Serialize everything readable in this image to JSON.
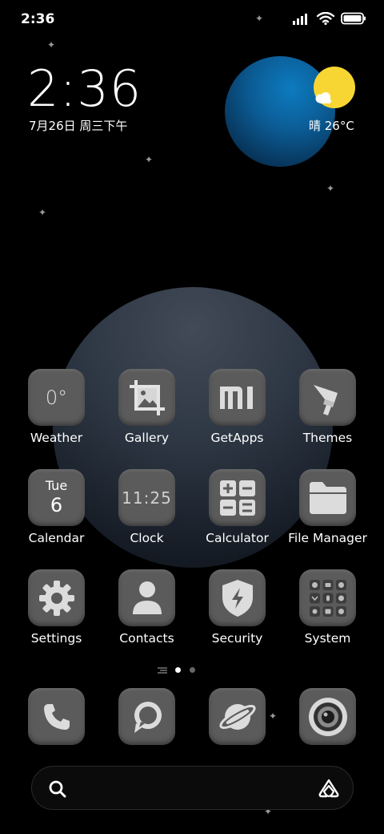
{
  "status_bar": {
    "time": "2:36",
    "icons": [
      "signal-icon",
      "wifi-icon",
      "battery-icon"
    ]
  },
  "widget": {
    "clock": "2:36",
    "date": "7月26日 周三下午",
    "weather": "晴 26°C",
    "weather_icon": "sunny-cloud-icon"
  },
  "apps": [
    {
      "label": "Weather",
      "icon": "weather-icon",
      "icon_text": "0°"
    },
    {
      "label": "Gallery",
      "icon": "gallery-icon"
    },
    {
      "label": "GetApps",
      "icon": "mi-icon"
    },
    {
      "label": "Themes",
      "icon": "paintbrush-icon"
    },
    {
      "label": "Calendar",
      "icon": "calendar-icon",
      "icon_day": "Tue",
      "icon_date": "6"
    },
    {
      "label": "Clock",
      "icon": "clock-icon",
      "icon_text": "11:25"
    },
    {
      "label": "Calculator",
      "icon": "calculator-icon"
    },
    {
      "label": "File Manager",
      "icon": "folder-icon"
    },
    {
      "label": "Settings",
      "icon": "gear-icon"
    },
    {
      "label": "Contacts",
      "icon": "person-icon"
    },
    {
      "label": "Security",
      "icon": "shield-icon"
    },
    {
      "label": "System",
      "icon": "system-folder-icon"
    }
  ],
  "dock": [
    {
      "name": "phone",
      "icon": "phone-icon"
    },
    {
      "name": "messaging",
      "icon": "message-icon"
    },
    {
      "name": "browser",
      "icon": "planet-icon"
    },
    {
      "name": "camera",
      "icon": "camera-icon"
    }
  ],
  "pages": {
    "count": 2,
    "active": 1
  },
  "search": {
    "icon": "search-icon",
    "assistant_icon": "assistant-icon"
  },
  "colors": {
    "background": "#000000",
    "icon_bg": "#5b5b5b",
    "sun": "#f7d633",
    "planet_blue": "#0b5c95"
  }
}
